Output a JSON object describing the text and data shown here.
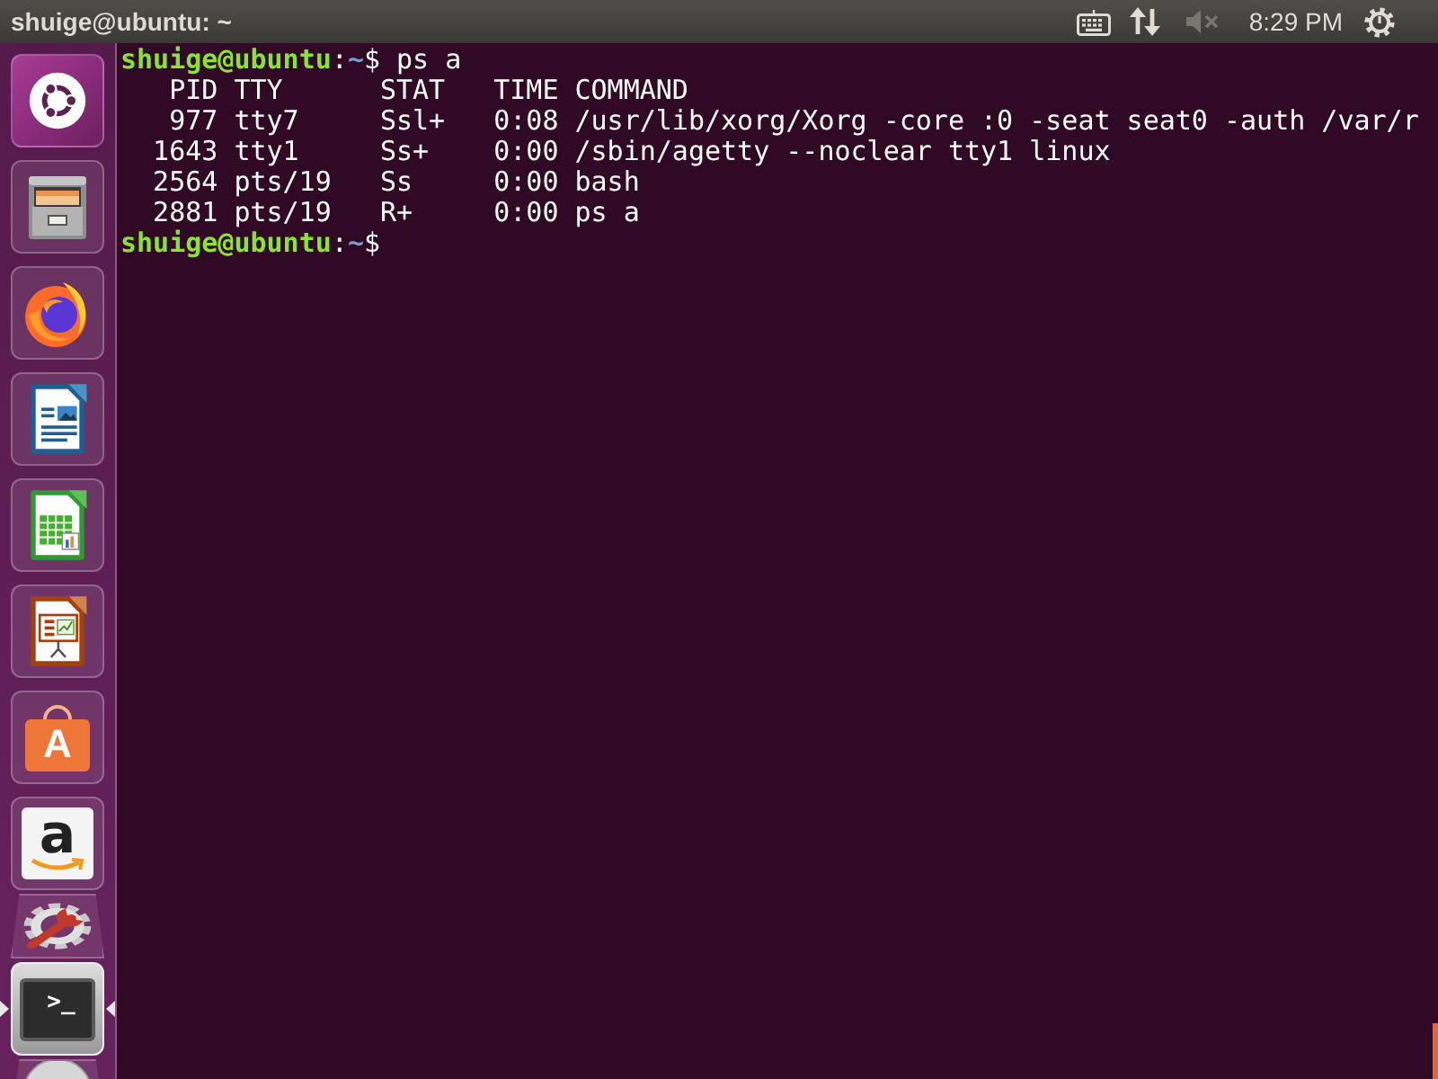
{
  "top_bar": {
    "title": "shuige@ubuntu: ~",
    "sound": {
      "muted": true
    },
    "clock": "8:29 PM"
  },
  "launcher": {
    "items": [
      {
        "kind": "dash",
        "running": false,
        "focused": false,
        "folded": false
      },
      {
        "kind": "files",
        "running": false,
        "focused": false,
        "folded": false
      },
      {
        "kind": "browser",
        "running": false,
        "focused": false,
        "folded": false
      },
      {
        "kind": "writer",
        "running": false,
        "focused": false,
        "folded": false
      },
      {
        "kind": "calc",
        "running": false,
        "focused": false,
        "folded": false
      },
      {
        "kind": "impress",
        "running": false,
        "focused": false,
        "folded": false
      },
      {
        "kind": "software",
        "glyph": "A",
        "running": false,
        "focused": false,
        "folded": false
      },
      {
        "kind": "store",
        "glyph": "a",
        "running": false,
        "focused": false,
        "folded": false
      },
      {
        "kind": "settings",
        "running": false,
        "focused": false,
        "folded": true
      },
      {
        "kind": "terminal",
        "glyph": ">_",
        "running": true,
        "focused": true,
        "folded": false
      },
      {
        "kind": "disc",
        "running": false,
        "focused": false,
        "folded": true
      }
    ]
  },
  "terminal": {
    "blocks": [
      {
        "kind": "prompt",
        "user": "shuige@ubuntu",
        "separator": ":",
        "cwd": "~",
        "symbol": "$",
        "command": "ps a"
      },
      {
        "kind": "table",
        "columns": [
          "PID",
          "TTY",
          "STAT",
          "TIME",
          "COMMAND"
        ],
        "rows": [
          [
            "977",
            "tty7",
            "Ssl+",
            "0:08",
            "/usr/lib/xorg/Xorg -core :0 -seat seat0 -auth /var/r"
          ],
          [
            "1643",
            "tty1",
            "Ss+",
            "0:00",
            "/sbin/agetty --noclear tty1 linux"
          ],
          [
            "2564",
            "pts/19",
            "Ss",
            "0:00",
            "bash"
          ],
          [
            "2881",
            "pts/19",
            "R+",
            "0:00",
            "ps a"
          ]
        ]
      },
      {
        "kind": "prompt",
        "user": "shuige@ubuntu",
        "separator": ":",
        "cwd": "~",
        "symbol": "$"
      }
    ]
  }
}
